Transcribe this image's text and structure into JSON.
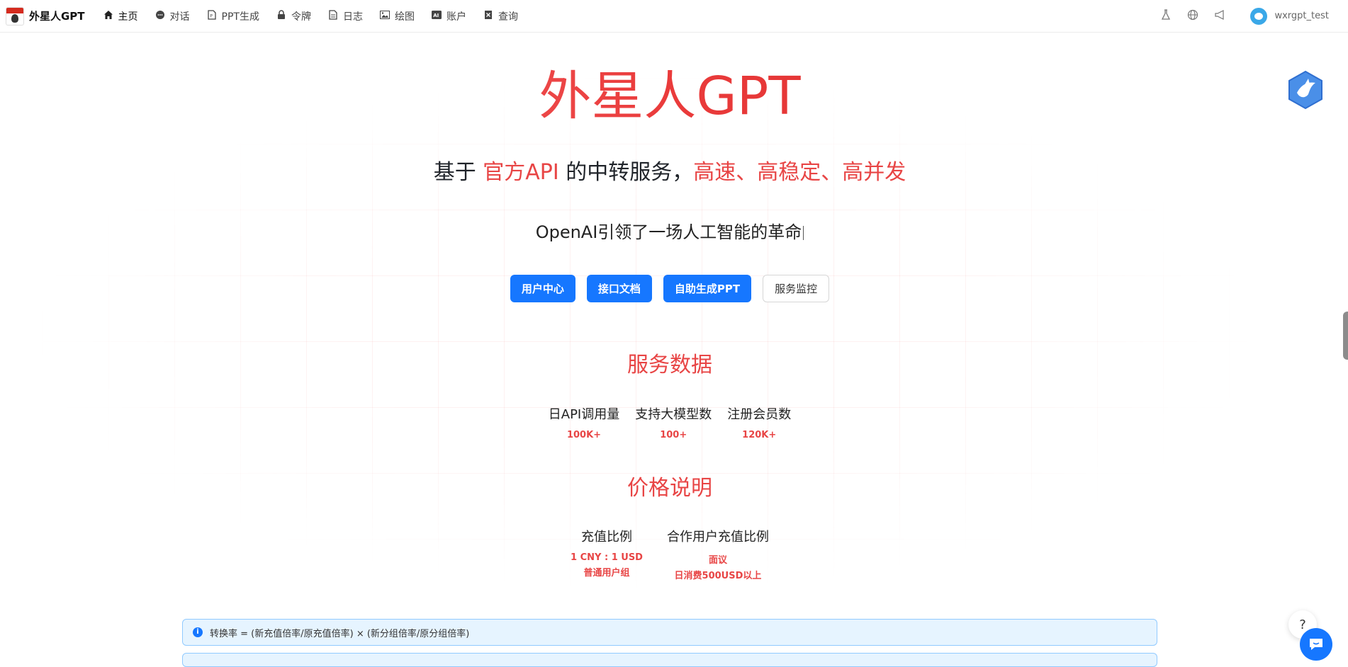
{
  "nav": {
    "brand": "外星人GPT",
    "items": [
      {
        "label": "主页",
        "icon": "home-icon"
      },
      {
        "label": "对话",
        "icon": "chat-icon"
      },
      {
        "label": "PPT生成",
        "icon": "file-icon"
      },
      {
        "label": "令牌",
        "icon": "lock-icon"
      },
      {
        "label": "日志",
        "icon": "document-icon"
      },
      {
        "label": "绘图",
        "icon": "image-icon"
      },
      {
        "label": "账户",
        "icon": "ai-icon"
      },
      {
        "label": "查询",
        "icon": "query-icon"
      }
    ],
    "user": "wxrgpt_test"
  },
  "hero": {
    "title": "外星人GPT",
    "subtitle_pre": "基于 ",
    "subtitle_accent1": "官方API",
    "subtitle_mid": " 的中转服务，",
    "subtitle_accent2": "高速、高稳定、高并发",
    "typed": "OpenAI引领了一场人工智能的革命"
  },
  "buttons": {
    "user_center": "用户中心",
    "api_docs": "接口文档",
    "ppt": "自助生成PPT",
    "monitor": "服务监控"
  },
  "service_data": {
    "title": "服务数据",
    "stats": [
      {
        "label": "日API调用量",
        "value": "100K+"
      },
      {
        "label": "支持大模型数",
        "value": "100+"
      },
      {
        "label": "注册会员数",
        "value": "120K+"
      }
    ]
  },
  "pricing": {
    "title": "价格说明",
    "items": [
      {
        "label": "充值比例",
        "value_pre": "1 CNY : ",
        "value_strong": "1 USD",
        "sub": "普通用户组"
      },
      {
        "label": "合作用户充值比例",
        "value": "面议",
        "sub": "日消费500USD以上"
      }
    ]
  },
  "info": {
    "text": "转换率 = (新充值倍率/原充值倍率) × (新分组倍率/原分组倍率)"
  },
  "colors": {
    "accent": "#e84545",
    "primary": "#1677ff"
  }
}
